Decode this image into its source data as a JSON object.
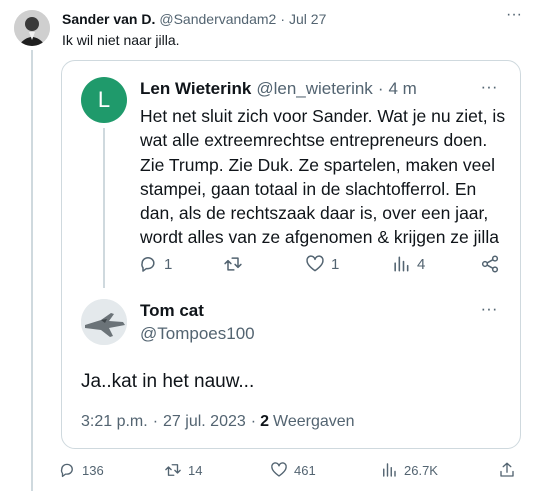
{
  "outer_tweet": {
    "author_name": "Sander van D.",
    "handle": "@Sandervandam2",
    "separator": "·",
    "date": "Jul 27",
    "text": "Ik wil niet naar jilla.",
    "more": "···",
    "actions": {
      "replies": "136",
      "retweets": "14",
      "likes": "461",
      "views": "26.7K"
    }
  },
  "quoted": {
    "len": {
      "avatar_letter": "L",
      "avatar_color": "#1f9a6b",
      "author_name": "Len Wieterink",
      "handle": "@len_wieterink",
      "separator": "·",
      "time": "4 m",
      "more": "···",
      "lines": [
        "Het net sluit zich voor Sander. Wat je nu ziet, is",
        "wat alle extreemrechtse entrepreneurs doen.",
        "Zie Trump. Zie Duk. Ze spartelen, maken veel",
        "stampei, gaan totaal in de slachtofferrol. En",
        "dan, als de rechtszaak daar is, over een jaar,",
        "wordt alles van ze afgenomen & krijgen ze jilla"
      ],
      "actions": {
        "replies": "1",
        "retweets": "",
        "likes": "1",
        "views": "4"
      }
    },
    "tom": {
      "author_name": "Tom cat",
      "handle": "@Tompoes100",
      "more": "···",
      "text": "Ja..kat in het nauw...",
      "time": "3:21 p.m.",
      "separator": "·",
      "date": "27 jul. 2023",
      "views_count": "2",
      "views_label": "Weergaven"
    }
  },
  "colors": {
    "text": "#0f1419",
    "secondary": "#536471",
    "border": "#cfd9de"
  }
}
